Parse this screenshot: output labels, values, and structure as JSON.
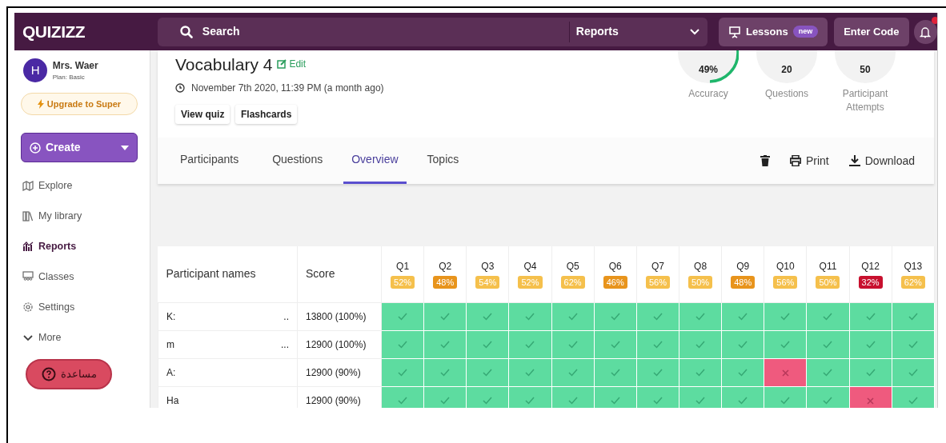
{
  "topbar": {
    "logo": "QUIZIZZ",
    "search_placeholder": "Search",
    "menu": "Reports",
    "lessons": "Lessons",
    "lessons_badge": "new",
    "enter_code": "Enter Code"
  },
  "sidebar": {
    "user": {
      "initial": "H",
      "name": "Mrs. Waer",
      "plan": "Plan: Basic"
    },
    "upgrade": "Upgrade to Super",
    "create": "Create",
    "items": [
      {
        "label": "Explore",
        "selected": false
      },
      {
        "label": "My library",
        "selected": false
      },
      {
        "label": "Reports",
        "selected": true
      },
      {
        "label": "Classes",
        "selected": false
      },
      {
        "label": "Settings",
        "selected": false
      },
      {
        "label": "More",
        "selected": false
      }
    ],
    "help": "مساعدة"
  },
  "report": {
    "title": "Vocabulary 4",
    "edit": "Edit",
    "date": "November 7th 2020, 11:39 PM (a month ago)",
    "buttons": [
      "View quiz",
      "Flashcards"
    ],
    "stats": [
      {
        "value": "49%",
        "label": "Accuracy"
      },
      {
        "value": "20",
        "label": "Questions"
      },
      {
        "value": "50",
        "label": "Participant Attempts"
      }
    ],
    "tabs": [
      {
        "label": "Participants",
        "selected": false
      },
      {
        "label": "Questions",
        "selected": false
      },
      {
        "label": "Overview",
        "selected": true
      },
      {
        "label": "Topics",
        "selected": false
      }
    ],
    "actions": [
      "Print",
      "Download"
    ]
  },
  "table": {
    "columns": [
      "Participant names",
      "Score"
    ],
    "questions": [
      {
        "label": "Q1",
        "percent": "52%",
        "color": "#f5c04c"
      },
      {
        "label": "Q2",
        "percent": "48%",
        "color": "#e8941c"
      },
      {
        "label": "Q3",
        "percent": "54%",
        "color": "#f5c04c"
      },
      {
        "label": "Q4",
        "percent": "52%",
        "color": "#f5c04c"
      },
      {
        "label": "Q5",
        "percent": "62%",
        "color": "#f5c04c"
      },
      {
        "label": "Q6",
        "percent": "46%",
        "color": "#e8941c"
      },
      {
        "label": "Q7",
        "percent": "56%",
        "color": "#f5c04c"
      },
      {
        "label": "Q8",
        "percent": "50%",
        "color": "#f5c04c"
      },
      {
        "label": "Q9",
        "percent": "48%",
        "color": "#e8941c"
      },
      {
        "label": "Q10",
        "percent": "56%",
        "color": "#f5c04c"
      },
      {
        "label": "Q11",
        "percent": "50%",
        "color": "#f5c04c"
      },
      {
        "label": "Q12",
        "percent": "32%",
        "color": "#c8102e"
      },
      {
        "label": "Q13",
        "percent": "62%",
        "color": "#f5c04c"
      }
    ],
    "rows": [
      {
        "name": "K:",
        "ellipsis": "..",
        "score": "13800 (100%)",
        "answers": [
          true,
          true,
          true,
          true,
          true,
          true,
          true,
          true,
          true,
          true,
          true,
          true,
          true
        ]
      },
      {
        "name": "m",
        "ellipsis": "...",
        "score": "12900 (100%)",
        "answers": [
          true,
          true,
          true,
          true,
          true,
          true,
          true,
          true,
          true,
          true,
          true,
          true,
          true
        ]
      },
      {
        "name": "A:",
        "score": "12900 (90%)",
        "answers": [
          true,
          true,
          true,
          true,
          true,
          true,
          true,
          true,
          true,
          false,
          true,
          true,
          true
        ]
      },
      {
        "name": "Ha",
        "score": "12900 (90%)",
        "answers": [
          true,
          true,
          true,
          true,
          true,
          true,
          true,
          true,
          true,
          true,
          true,
          false,
          true
        ]
      }
    ]
  }
}
